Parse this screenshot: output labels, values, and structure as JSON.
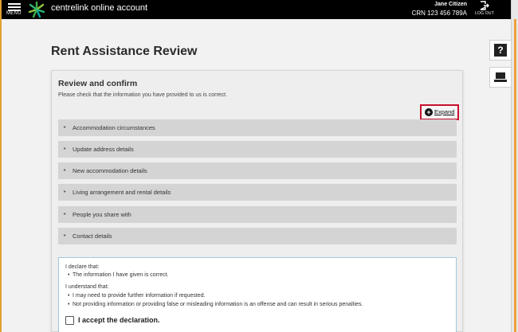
{
  "header": {
    "menu_label": "MENU",
    "app_title": "centrelink online account",
    "user_name": "Jane Citizen",
    "crn": "CRN 123 456 789A",
    "logout_label": "LOG OUT"
  },
  "page": {
    "title": "Rent Assistance Review"
  },
  "side_buttons": [
    {
      "icon": "help-icon",
      "glyph": "?"
    },
    {
      "icon": "computer-icon"
    }
  ],
  "card": {
    "title": "Review and confirm",
    "subtitle": "Please check that the information you have provided to us is correct.",
    "expand_label": "Expand",
    "sections": [
      "Accommodation circumstances",
      "Update address details",
      "New accommodation details",
      "Living arrangement and rental details",
      "People you share with",
      "Contact details"
    ]
  },
  "declaration": {
    "declare_heading": "I declare that:",
    "declare_items": [
      "The information I have given is correct."
    ],
    "understand_heading": "I understand that:",
    "understand_items": [
      "I may need to provide further information if requested.",
      "Not providing information or providing false or misleading information is an offense and can result in serious penalties."
    ],
    "accept_label": "I accept the declaration."
  },
  "colors": {
    "header_bg": "#000000",
    "highlight_border": "#c8102e",
    "section_bg": "#d4d4d4",
    "declaration_border": "#9ec7dd"
  }
}
